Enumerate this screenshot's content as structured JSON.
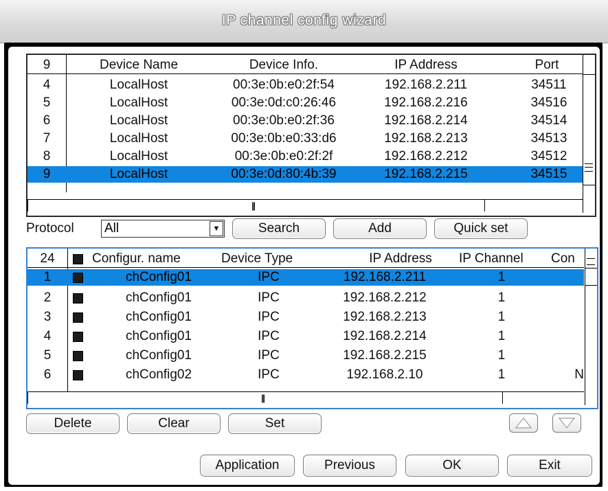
{
  "window": {
    "title": "IP channel config wizard"
  },
  "device_list": {
    "headers": {
      "index": "9",
      "name": "Device Name",
      "info": "Device Info.",
      "ip": "IP Address",
      "port": "Port"
    },
    "rows": [
      {
        "index": "4",
        "name": "LocalHost",
        "info": "00:3e:0b:e0:2f:54",
        "ip": "192.168.2.211",
        "port": "34511"
      },
      {
        "index": "5",
        "name": "LocalHost",
        "info": "00:3e:0d:c0:26:46",
        "ip": "192.168.2.216",
        "port": "34516"
      },
      {
        "index": "6",
        "name": "LocalHost",
        "info": "00:3e:0b:e0:2f:36",
        "ip": "192.168.2.214",
        "port": "34514"
      },
      {
        "index": "7",
        "name": "LocalHost",
        "info": "00:3e:0b:e0:33:d6",
        "ip": "192.168.2.213",
        "port": "34513"
      },
      {
        "index": "8",
        "name": "LocalHost",
        "info": "00:3e:0b:e0:2f:2f",
        "ip": "192.168.2.212",
        "port": "34512"
      },
      {
        "index": "9",
        "name": "LocalHost",
        "info": "00:3e:0d:80:4b:39",
        "ip": "192.168.2.215",
        "port": "34515"
      }
    ]
  },
  "search_bar": {
    "protocol_label": "Protocol",
    "protocol_value": "All",
    "search_label": "Search",
    "add_label": "Add",
    "quick_set_label": "Quick set"
  },
  "config_list": {
    "headers": {
      "index": "24",
      "name": "Configur. name",
      "type": "Device Type",
      "ip": "IP Address",
      "channel": "IP Channel",
      "con": "Con"
    },
    "rows": [
      {
        "index": "1",
        "name": "chConfig01",
        "type": "IPC",
        "ip": "192.168.2.211",
        "channel": "1",
        "con": ""
      },
      {
        "index": "2",
        "name": "chConfig01",
        "type": "IPC",
        "ip": "192.168.2.212",
        "channel": "1",
        "con": ""
      },
      {
        "index": "3",
        "name": "chConfig01",
        "type": "IPC",
        "ip": "192.168.2.213",
        "channel": "1",
        "con": ""
      },
      {
        "index": "4",
        "name": "chConfig01",
        "type": "IPC",
        "ip": "192.168.2.214",
        "channel": "1",
        "con": ""
      },
      {
        "index": "5",
        "name": "chConfig01",
        "type": "IPC",
        "ip": "192.168.2.215",
        "channel": "1",
        "con": ""
      },
      {
        "index": "6",
        "name": "chConfig02",
        "type": "IPC",
        "ip": "192.168.2.10",
        "channel": "1",
        "con": "N"
      }
    ]
  },
  "config_actions": {
    "delete_label": "Delete",
    "clear_label": "Clear",
    "set_label": "Set"
  },
  "footer": {
    "application_label": "Application",
    "previous_label": "Previous",
    "ok_label": "OK",
    "exit_label": "Exit"
  },
  "colors": {
    "selection": "#1086e0",
    "frame": "#000000",
    "title_bg": "#d9d9d9"
  }
}
